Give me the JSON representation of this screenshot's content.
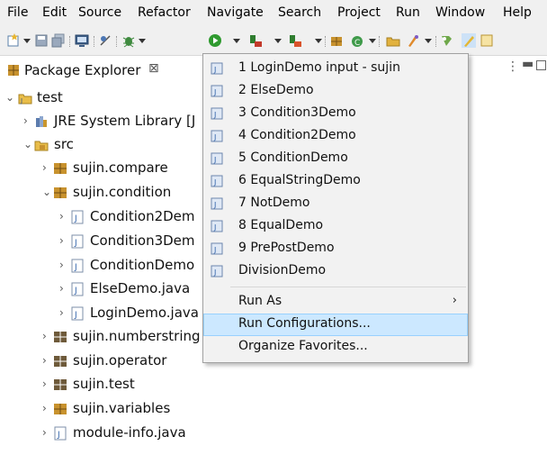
{
  "menubar": {
    "items": [
      "File",
      "Edit",
      "Source",
      "Refactor",
      "Navigate",
      "Search",
      "Project",
      "Run",
      "Window",
      "Help"
    ]
  },
  "package_explorer": {
    "title": "Package Explorer",
    "close_glyph": "⊠",
    "tree": [
      {
        "label": "test",
        "icon": "project-icon",
        "expanded": true
      },
      {
        "label": "JRE System Library [J",
        "icon": "library-icon",
        "expanded": false
      },
      {
        "label": "src",
        "icon": "source-folder-icon",
        "expanded": true
      },
      {
        "label": "sujin.compare",
        "icon": "package-icon",
        "expanded": false
      },
      {
        "label": "sujin.condition",
        "icon": "package-icon",
        "expanded": true
      },
      {
        "label": "Condition2Dem",
        "icon": "java-file-icon",
        "expanded": false
      },
      {
        "label": "Condition3Dem",
        "icon": "java-file-icon",
        "expanded": false
      },
      {
        "label": "ConditionDemo",
        "icon": "java-file-icon",
        "expanded": false
      },
      {
        "label": "ElseDemo.java",
        "icon": "java-file-icon",
        "expanded": false
      },
      {
        "label": "LoginDemo.java",
        "icon": "java-file-icon",
        "expanded": false
      },
      {
        "label": "sujin.numberstring",
        "icon": "package-icon",
        "expanded": false
      },
      {
        "label": "sujin.operator",
        "icon": "package-icon",
        "expanded": false
      },
      {
        "label": "sujin.test",
        "icon": "package-icon",
        "expanded": false
      },
      {
        "label": "sujin.variables",
        "icon": "package-icon",
        "expanded": false
      },
      {
        "label": "module-info.java",
        "icon": "java-file-icon",
        "expanded": false
      }
    ]
  },
  "run_menu": {
    "history": [
      "1 LoginDemo input - sujin",
      "2 ElseDemo",
      "3 Condition3Demo",
      "4 Condition2Demo",
      "5 ConditionDemo",
      "6 EqualStringDemo",
      "7 NotDemo",
      "8 EqualDemo",
      "9 PrePostDemo",
      "DivisionDemo"
    ],
    "run_as": "Run As",
    "run_as_arrow": "›",
    "run_configurations": "Run Configurations...",
    "organize_favorites": "Organize Favorites...",
    "highlighted": "Run Configurations..."
  },
  "colors": {
    "highlight_bg": "#cce8ff",
    "menu_bg": "#f2f2f2",
    "chrome_bg": "#f0f0f0"
  }
}
